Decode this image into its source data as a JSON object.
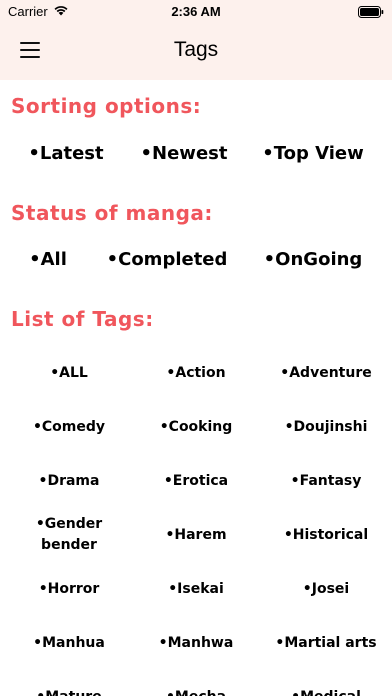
{
  "status_bar": {
    "carrier": "Carrier",
    "time": "2:36 AM"
  },
  "nav": {
    "title": "Tags"
  },
  "sorting": {
    "title": "Sorting options:",
    "options": [
      "•Latest",
      "•Newest",
      "•Top View"
    ]
  },
  "status": {
    "title": "Status of manga:",
    "options": [
      "•All",
      "•Completed",
      "•OnGoing"
    ]
  },
  "tags": {
    "title": "List of Tags:",
    "items": [
      "•ALL",
      "•Action",
      "•Adventure",
      "•Comedy",
      "•Cooking",
      "•Doujinshi",
      "•Drama",
      "•Erotica",
      "•Fantasy",
      "•Gender bender",
      "•Harem",
      "•Historical",
      "•Horror",
      "•Isekai",
      "•Josei",
      "•Manhua",
      "•Manhwa",
      "•Martial arts",
      "•Mature",
      "•Mecha",
      "•Medical"
    ]
  },
  "colors": {
    "accent": "#f0565c",
    "header_bg": "#fdf1ed"
  },
  "icons": {
    "menu": "hamburger-menu-icon",
    "wifi": "wifi-icon",
    "battery": "battery-icon"
  }
}
